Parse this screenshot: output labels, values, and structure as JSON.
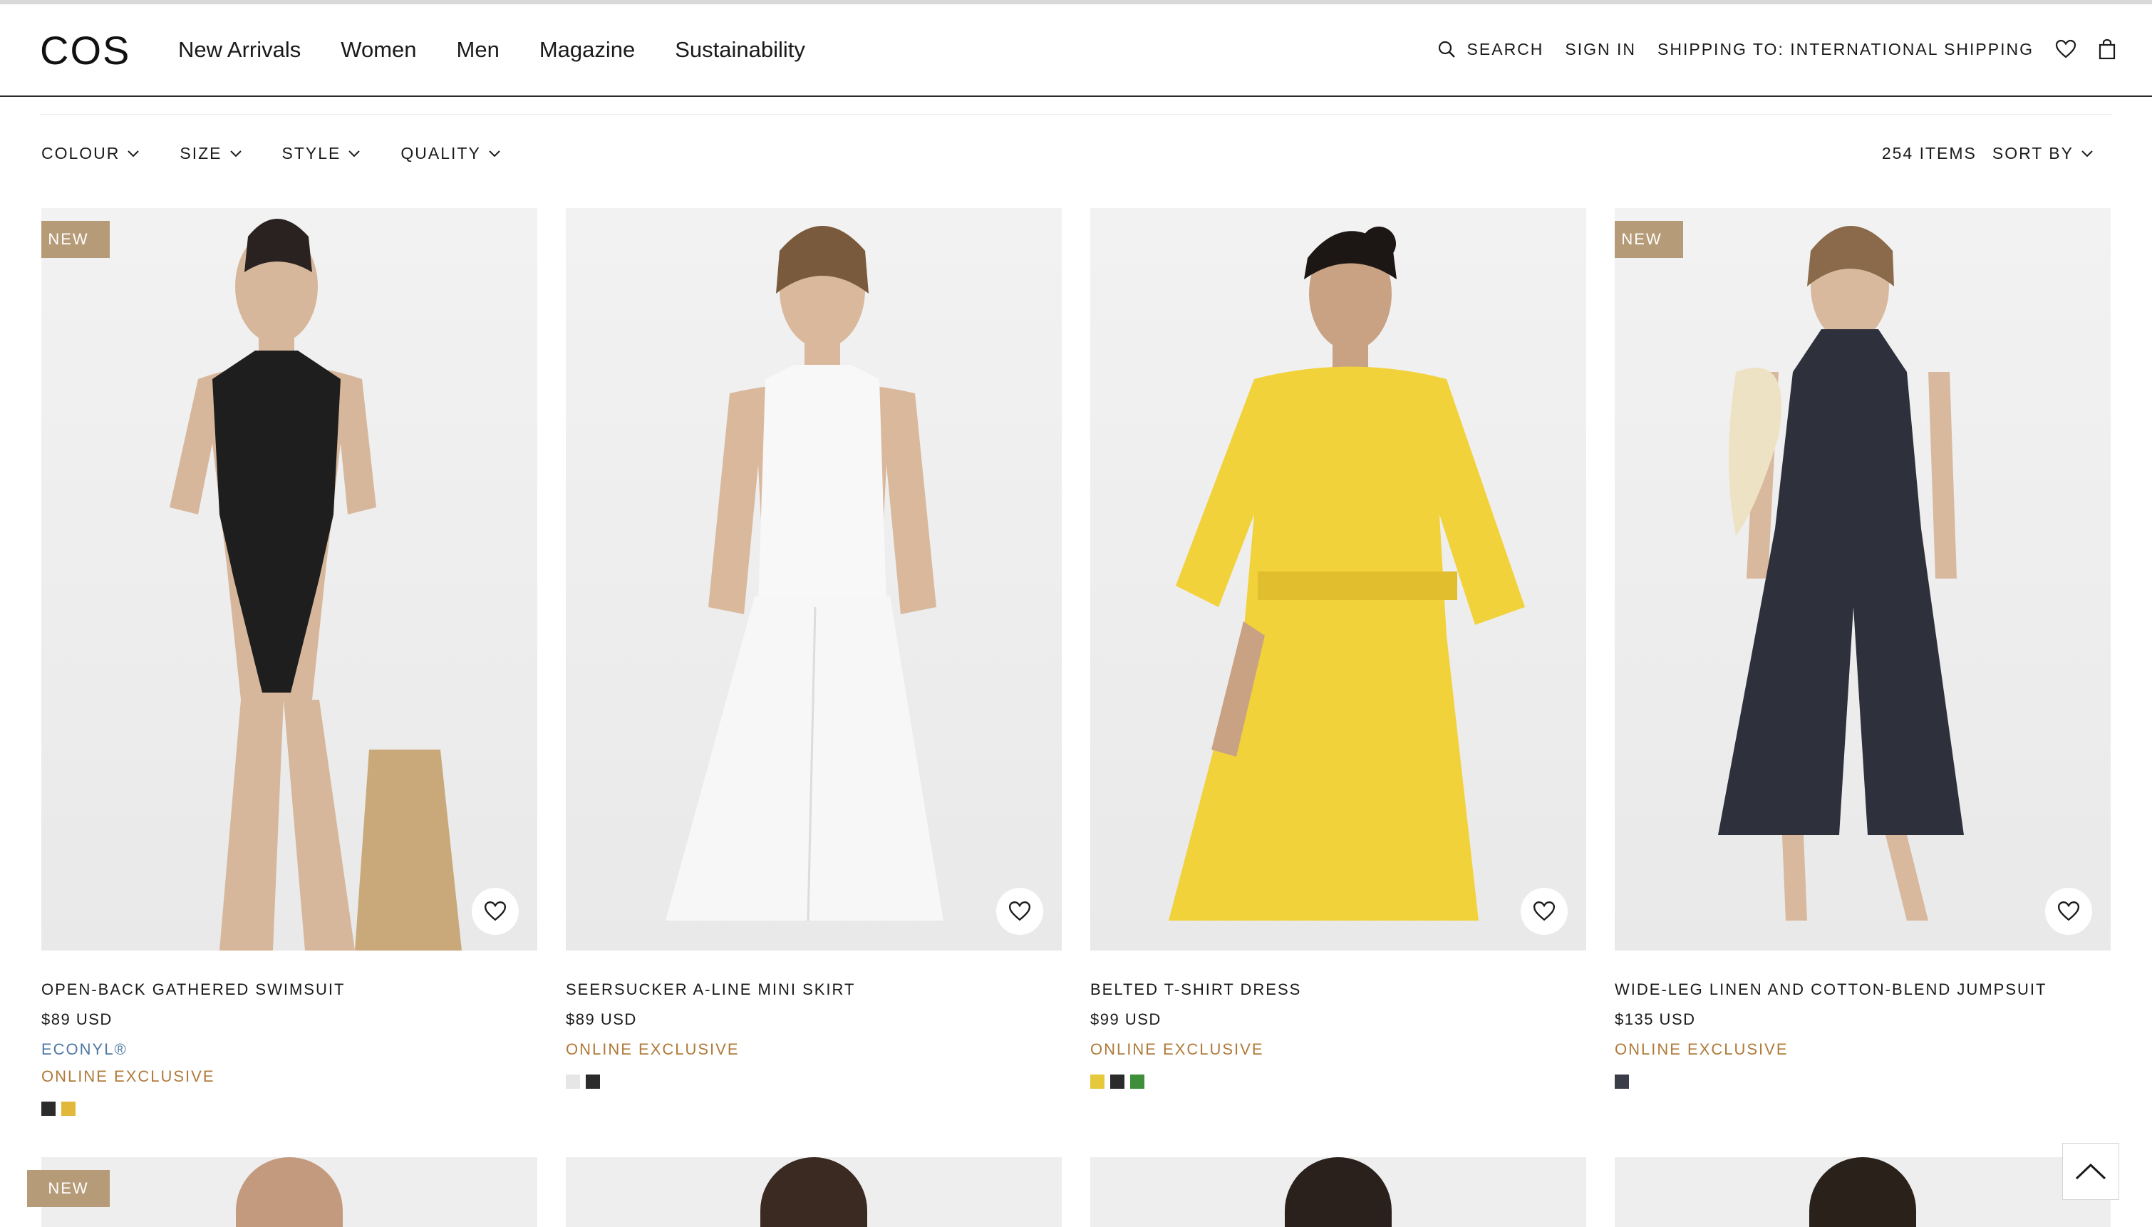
{
  "header": {
    "logo": "COS",
    "nav": [
      "New Arrivals",
      "Women",
      "Men",
      "Magazine",
      "Sustainability"
    ],
    "search_label": "SEARCH",
    "sign_in_label": "SIGN IN",
    "shipping_label": "SHIPPING TO: INTERNATIONAL SHIPPING"
  },
  "filters": {
    "items": [
      "COLOUR",
      "SIZE",
      "STYLE",
      "QUALITY"
    ],
    "items_count": "254 ITEMS",
    "sort_label": "SORT BY"
  },
  "products": [
    {
      "badge": "NEW",
      "name": "OPEN-BACK GATHERED SWIMSUIT",
      "price": "$89 USD",
      "econyl": "ECONYL®",
      "online": "ONLINE EXCLUSIVE",
      "swatches": [
        "#2b2b2b",
        "#e3b73a"
      ],
      "garment_color": "#1e1e1e"
    },
    {
      "badge": "",
      "name": "SEERSUCKER A-LINE MINI SKIRT",
      "price": "$89 USD",
      "econyl": "",
      "online": "ONLINE EXCLUSIVE",
      "swatches": [
        "#e6e6e6",
        "#2b2b2b"
      ],
      "garment_color": "#f7f7f7"
    },
    {
      "badge": "",
      "name": "BELTED T-SHIRT DRESS",
      "price": "$99 USD",
      "econyl": "",
      "online": "ONLINE EXCLUSIVE",
      "swatches": [
        "#e6c93a",
        "#2b2b2b",
        "#3f8f3a"
      ],
      "garment_color": "#f2d23a"
    },
    {
      "badge": "NEW",
      "name": "WIDE-LEG LINEN AND COTTON-BLEND JUMPSUIT",
      "price": "$135 USD",
      "econyl": "",
      "online": "ONLINE EXCLUSIVE",
      "swatches": [
        "#3a3d48"
      ],
      "garment_color": "#2e313c"
    }
  ],
  "row2": [
    {
      "badge": "NEW"
    },
    {
      "badge": ""
    },
    {
      "badge": ""
    },
    {
      "badge": ""
    }
  ]
}
